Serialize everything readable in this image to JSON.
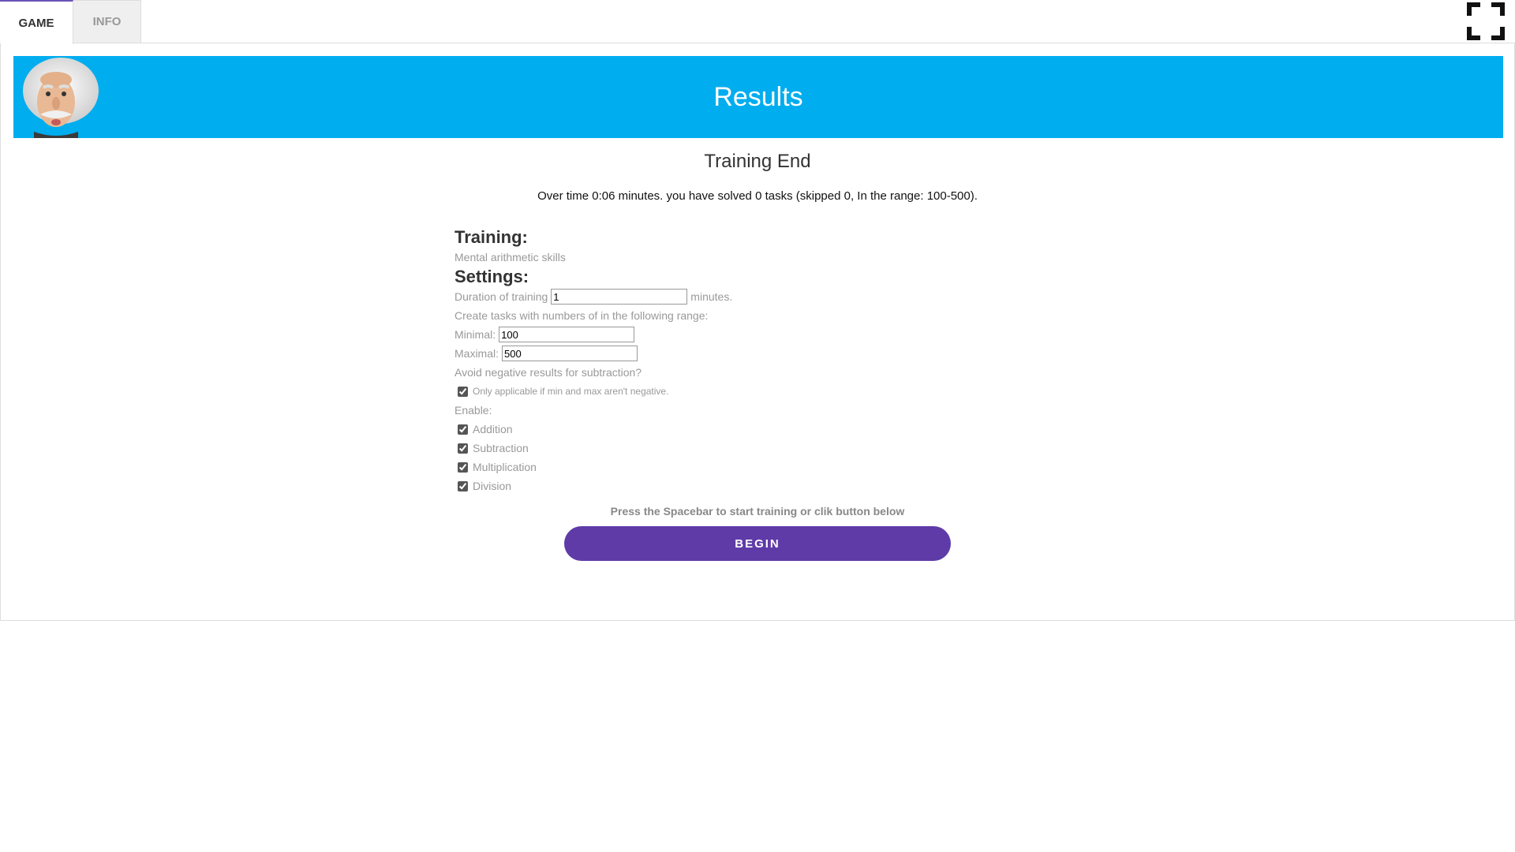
{
  "tabs": [
    {
      "label": "GAME",
      "active": true
    },
    {
      "label": "INFO",
      "active": false
    }
  ],
  "header": {
    "title": "Results"
  },
  "result": {
    "title": "Training End",
    "summary": "Over time 0:06 minutes. you have solved 0 tasks (skipped 0, In the range: 100-500)."
  },
  "training": {
    "heading": "Training:",
    "name": "Mental arithmetic skills"
  },
  "settings": {
    "heading": "Settings:",
    "duration_label": "Duration of training",
    "duration_value": "1",
    "duration_unit": "minutes.",
    "range_label": "Create tasks with numbers of in the following range:",
    "min_label": "Minimal:",
    "min_value": "100",
    "max_label": "Maximal:",
    "max_value": "500",
    "avoid_negative_label": "Avoid negative results for subtraction?",
    "avoid_negative_note": "Only applicable if min and max aren't negative.",
    "enable_label": "Enable:",
    "operations": [
      "Addition",
      "Subtraction",
      "Multiplication",
      "Division"
    ]
  },
  "prompt": "Press the Spacebar to start training or clik button below",
  "begin_label": "BEGIN",
  "colors": {
    "header": "#00adee",
    "button": "#5f3ba8",
    "active_tab_border": "#6a52b8"
  },
  "icons": {
    "fullscreen": "fullscreen-icon",
    "avatar": "einstein-avatar"
  }
}
